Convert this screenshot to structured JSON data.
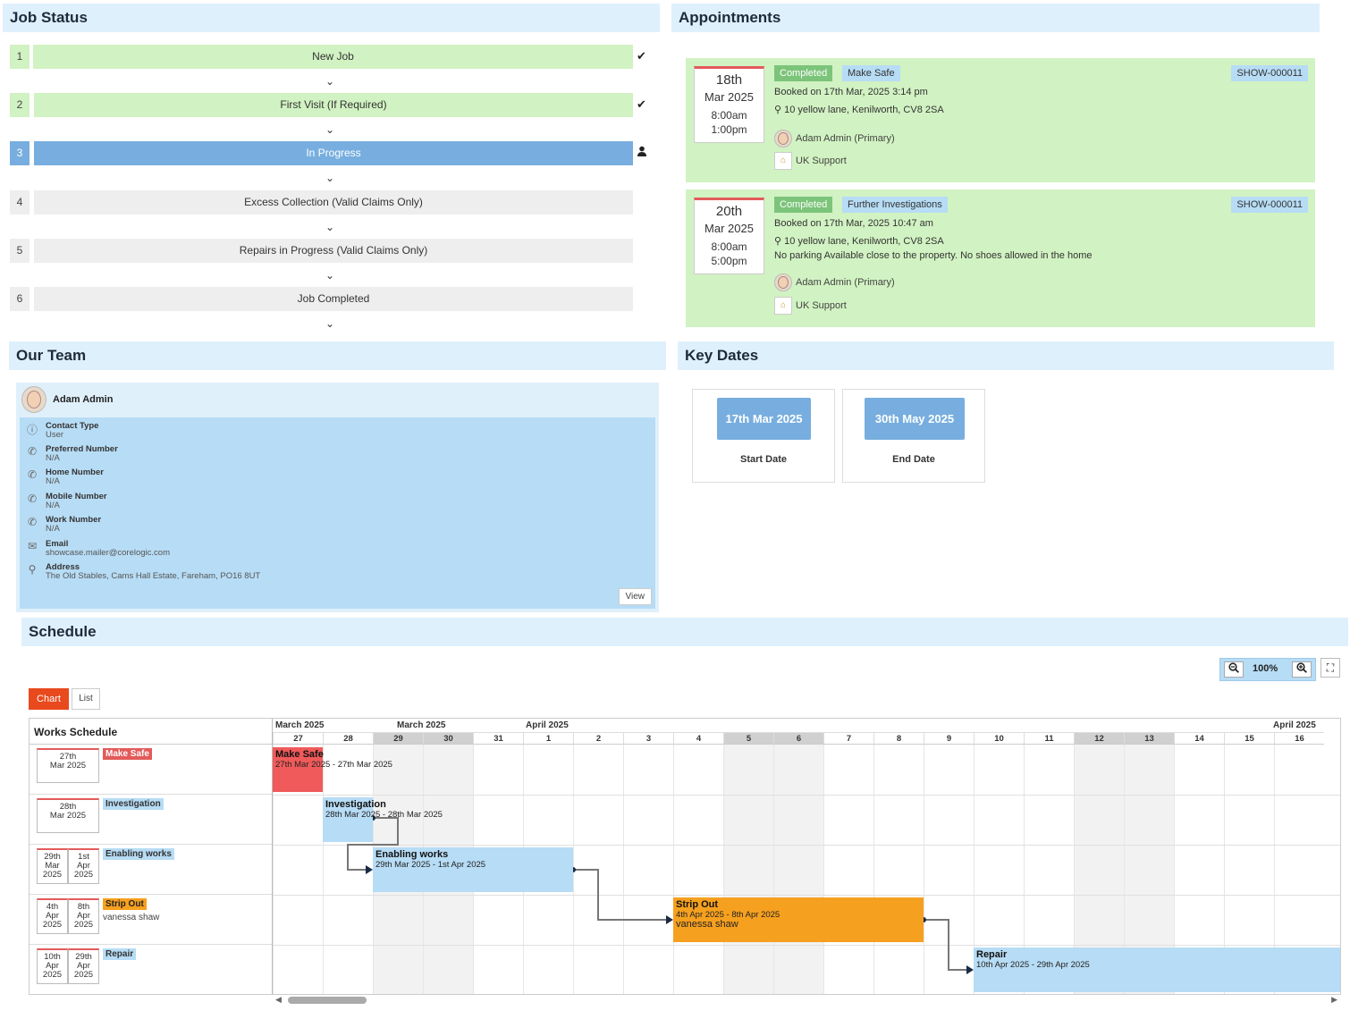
{
  "job_status": {
    "title": "Job Status",
    "steps": [
      {
        "num": "1",
        "label": "New Job"
      },
      {
        "num": "2",
        "label": "First Visit (If Required)"
      },
      {
        "num": "3",
        "label": "In Progress"
      },
      {
        "num": "4",
        "label": "Excess Collection (Valid Claims Only)"
      },
      {
        "num": "5",
        "label": "Repairs in Progress (Valid Claims Only)"
      },
      {
        "num": "6",
        "label": "Job Completed"
      }
    ]
  },
  "appointments": {
    "title": "Appointments",
    "items": [
      {
        "day": "18th",
        "month": "Mar 2025",
        "start": "8:00am",
        "end": "1:00pm",
        "status": "Completed",
        "type": "Make Safe",
        "ref": "SHOW-000011",
        "booked": "Booked on 17th Mar, 2025 3:14 pm",
        "address": "10 yellow lane, Kenilworth, CV8 2SA",
        "note": "",
        "primary": "Adam Admin (Primary)",
        "support": "UK Support"
      },
      {
        "day": "20th",
        "month": "Mar 2025",
        "start": "8:00am",
        "end": "5:00pm",
        "status": "Completed",
        "type": "Further Investigations",
        "ref": "SHOW-000011",
        "booked": "Booked on 17th Mar, 2025 10:47 am",
        "address": "10 yellow lane, Kenilworth, CV8 2SA",
        "note": "No parking Available close to the property. No shoes allowed in the home",
        "primary": "Adam Admin (Primary)",
        "support": "UK Support"
      }
    ]
  },
  "team": {
    "title": "Our Team",
    "member": {
      "name": "Adam Admin",
      "fields": [
        {
          "label": "Contact Type",
          "value": "User",
          "icon": "info-icon"
        },
        {
          "label": "Preferred Number",
          "value": "N/A",
          "icon": "phone-icon"
        },
        {
          "label": "Home Number",
          "value": "N/A",
          "icon": "phone-icon"
        },
        {
          "label": "Mobile Number",
          "value": "N/A",
          "icon": "phone-icon"
        },
        {
          "label": "Work Number",
          "value": "N/A",
          "icon": "phone-icon"
        },
        {
          "label": "Email",
          "value": "showcase.mailer@corelogic.com",
          "icon": "envelope-icon"
        },
        {
          "label": "Address",
          "value": "The Old Stables, Cams Hall Estate, Fareham, PO16 8UT",
          "icon": "map-pin-icon"
        }
      ],
      "view_label": "View"
    }
  },
  "key_dates": {
    "title": "Key Dates",
    "items": [
      {
        "date": "17th Mar 2025",
        "label": "Start Date"
      },
      {
        "date": "30th May 2025",
        "label": "End Date"
      }
    ]
  },
  "schedule": {
    "title": "Schedule",
    "zoom": "100%",
    "chart_label": "Chart",
    "list_label": "List",
    "left_header": "Works Schedule",
    "months": [
      "March 2025",
      "March 2025",
      "April 2025",
      "April 2025"
    ],
    "days": [
      "27",
      "28",
      "29",
      "30",
      "31",
      "1",
      "2",
      "3",
      "4",
      "5",
      "6",
      "7",
      "8",
      "9",
      "10",
      "11",
      "12",
      "13",
      "14",
      "15",
      "16"
    ],
    "tasks": [
      {
        "name": "Make Safe",
        "cal1": [
          "27th",
          "Mar 2025"
        ],
        "cal2": null,
        "assignee": "",
        "bar_title": "Make Safe",
        "bar_dates": "27th Mar 2025 - 27th Mar 2025",
        "bar_sub": ""
      },
      {
        "name": "Investigation",
        "cal1": [
          "28th",
          "Mar 2025"
        ],
        "cal2": null,
        "assignee": "",
        "bar_title": "Investigation",
        "bar_dates": "28th Mar 2025 - 28th Mar 2025",
        "bar_sub": ""
      },
      {
        "name": "Enabling works",
        "cal1": [
          "29th",
          "Mar",
          "2025"
        ],
        "cal2": [
          "1st",
          "Apr",
          "2025"
        ],
        "assignee": "",
        "bar_title": "Enabling works",
        "bar_dates": "29th Mar 2025 - 1st Apr 2025",
        "bar_sub": ""
      },
      {
        "name": "Strip Out",
        "cal1": [
          "4th",
          "Apr",
          "2025"
        ],
        "cal2": [
          "8th",
          "Apr",
          "2025"
        ],
        "assignee": "vanessa shaw",
        "bar_title": "Strip Out",
        "bar_dates": "4th Apr 2025 - 8th Apr 2025",
        "bar_sub": "vanessa shaw"
      },
      {
        "name": "Repair",
        "cal1": [
          "10th",
          "Apr",
          "2025"
        ],
        "cal2": [
          "29th",
          "Apr",
          "2025"
        ],
        "assignee": "",
        "bar_title": "Repair",
        "bar_dates": "10th Apr 2025 - 29th Apr 2025",
        "bar_sub": ""
      }
    ]
  },
  "colors": {
    "done": "#d1f2c2",
    "active": "#77aedf",
    "header": "#dff0fd",
    "make_safe": "#f05a5a",
    "blue_task": "#b7dcf5",
    "strip_out": "#f6a01f"
  }
}
